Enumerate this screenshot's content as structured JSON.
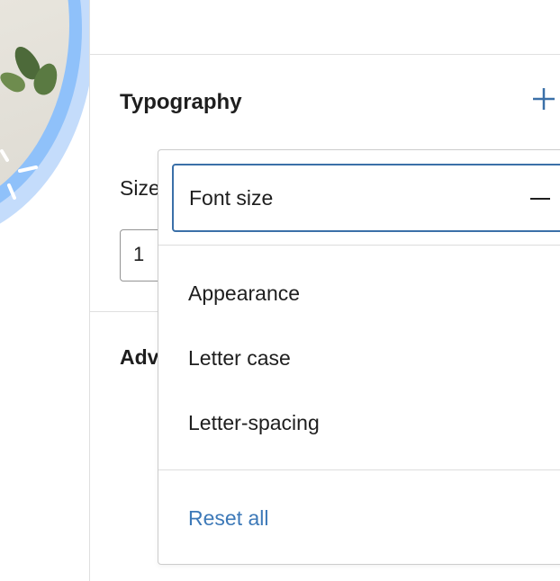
{
  "colors": {
    "accent": "#3b70a8",
    "link": "#3d79b8",
    "border": "#cccccc",
    "text": "#1e1e1e"
  },
  "panel": {
    "title": "Typography",
    "add_icon": "plus-icon",
    "size_label": "Size",
    "size_value": "1",
    "advanced_label": "Adv"
  },
  "menu": {
    "active_item": {
      "label": "Font size",
      "icon": "minus-icon"
    },
    "items": [
      {
        "label": "Appearance"
      },
      {
        "label": "Letter case"
      },
      {
        "label": "Letter-spacing"
      }
    ],
    "reset_label": "Reset all"
  }
}
